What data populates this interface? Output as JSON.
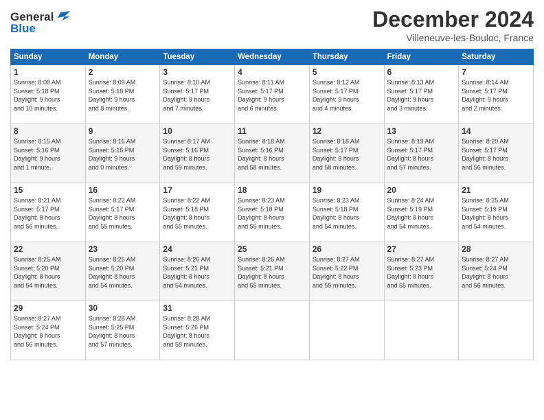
{
  "header": {
    "logo_general": "General",
    "logo_blue": "Blue",
    "month_title": "December 2024",
    "location": "Villeneuve-les-Bouloc, France"
  },
  "days_of_week": [
    "Sunday",
    "Monday",
    "Tuesday",
    "Wednesday",
    "Thursday",
    "Friday",
    "Saturday"
  ],
  "weeks": [
    [
      {
        "day": "1",
        "lines": [
          "Sunrise: 8:08 AM",
          "Sunset: 5:18 PM",
          "Daylight: 9 hours",
          "and 10 minutes."
        ]
      },
      {
        "day": "2",
        "lines": [
          "Sunrise: 8:09 AM",
          "Sunset: 5:18 PM",
          "Daylight: 9 hours",
          "and 8 minutes."
        ]
      },
      {
        "day": "3",
        "lines": [
          "Sunrise: 8:10 AM",
          "Sunset: 5:17 PM",
          "Daylight: 9 hours",
          "and 7 minutes."
        ]
      },
      {
        "day": "4",
        "lines": [
          "Sunrise: 8:11 AM",
          "Sunset: 5:17 PM",
          "Daylight: 9 hours",
          "and 6 minutes."
        ]
      },
      {
        "day": "5",
        "lines": [
          "Sunrise: 8:12 AM",
          "Sunset: 5:17 PM",
          "Daylight: 9 hours",
          "and 4 minutes."
        ]
      },
      {
        "day": "6",
        "lines": [
          "Sunrise: 8:13 AM",
          "Sunset: 5:17 PM",
          "Daylight: 9 hours",
          "and 3 minutes."
        ]
      },
      {
        "day": "7",
        "lines": [
          "Sunrise: 8:14 AM",
          "Sunset: 5:17 PM",
          "Daylight: 9 hours",
          "and 2 minutes."
        ]
      }
    ],
    [
      {
        "day": "8",
        "lines": [
          "Sunrise: 8:15 AM",
          "Sunset: 5:16 PM",
          "Daylight: 9 hours",
          "and 1 minute."
        ]
      },
      {
        "day": "9",
        "lines": [
          "Sunrise: 8:16 AM",
          "Sunset: 5:16 PM",
          "Daylight: 9 hours",
          "and 0 minutes."
        ]
      },
      {
        "day": "10",
        "lines": [
          "Sunrise: 8:17 AM",
          "Sunset: 5:16 PM",
          "Daylight: 8 hours",
          "and 59 minutes."
        ]
      },
      {
        "day": "11",
        "lines": [
          "Sunrise: 8:18 AM",
          "Sunset: 5:16 PM",
          "Daylight: 8 hours",
          "and 58 minutes."
        ]
      },
      {
        "day": "12",
        "lines": [
          "Sunrise: 8:18 AM",
          "Sunset: 5:17 PM",
          "Daylight: 8 hours",
          "and 58 minutes."
        ]
      },
      {
        "day": "13",
        "lines": [
          "Sunrise: 8:19 AM",
          "Sunset: 5:17 PM",
          "Daylight: 8 hours",
          "and 57 minutes."
        ]
      },
      {
        "day": "14",
        "lines": [
          "Sunrise: 8:20 AM",
          "Sunset: 5:17 PM",
          "Daylight: 8 hours",
          "and 56 minutes."
        ]
      }
    ],
    [
      {
        "day": "15",
        "lines": [
          "Sunrise: 8:21 AM",
          "Sunset: 5:17 PM",
          "Daylight: 8 hours",
          "and 56 minutes."
        ]
      },
      {
        "day": "16",
        "lines": [
          "Sunrise: 8:22 AM",
          "Sunset: 5:17 PM",
          "Daylight: 8 hours",
          "and 55 minutes."
        ]
      },
      {
        "day": "17",
        "lines": [
          "Sunrise: 8:22 AM",
          "Sunset: 5:18 PM",
          "Daylight: 8 hours",
          "and 55 minutes."
        ]
      },
      {
        "day": "18",
        "lines": [
          "Sunrise: 8:23 AM",
          "Sunset: 5:18 PM",
          "Daylight: 8 hours",
          "and 55 minutes."
        ]
      },
      {
        "day": "19",
        "lines": [
          "Sunrise: 8:23 AM",
          "Sunset: 5:18 PM",
          "Daylight: 8 hours",
          "and 54 minutes."
        ]
      },
      {
        "day": "20",
        "lines": [
          "Sunrise: 8:24 AM",
          "Sunset: 5:19 PM",
          "Daylight: 8 hours",
          "and 54 minutes."
        ]
      },
      {
        "day": "21",
        "lines": [
          "Sunrise: 8:25 AM",
          "Sunset: 5:19 PM",
          "Daylight: 8 hours",
          "and 54 minutes."
        ]
      }
    ],
    [
      {
        "day": "22",
        "lines": [
          "Sunrise: 8:25 AM",
          "Sunset: 5:20 PM",
          "Daylight: 8 hours",
          "and 54 minutes."
        ]
      },
      {
        "day": "23",
        "lines": [
          "Sunrise: 8:25 AM",
          "Sunset: 5:20 PM",
          "Daylight: 8 hours",
          "and 54 minutes."
        ]
      },
      {
        "day": "24",
        "lines": [
          "Sunrise: 8:26 AM",
          "Sunset: 5:21 PM",
          "Daylight: 8 hours",
          "and 54 minutes."
        ]
      },
      {
        "day": "25",
        "lines": [
          "Sunrise: 8:26 AM",
          "Sunset: 5:21 PM",
          "Daylight: 8 hours",
          "and 55 minutes."
        ]
      },
      {
        "day": "26",
        "lines": [
          "Sunrise: 8:27 AM",
          "Sunset: 5:22 PM",
          "Daylight: 8 hours",
          "and 55 minutes."
        ]
      },
      {
        "day": "27",
        "lines": [
          "Sunrise: 8:27 AM",
          "Sunset: 5:23 PM",
          "Daylight: 8 hours",
          "and 55 minutes."
        ]
      },
      {
        "day": "28",
        "lines": [
          "Sunrise: 8:27 AM",
          "Sunset: 5:24 PM",
          "Daylight: 8 hours",
          "and 56 minutes."
        ]
      }
    ],
    [
      {
        "day": "29",
        "lines": [
          "Sunrise: 8:27 AM",
          "Sunset: 5:24 PM",
          "Daylight: 8 hours",
          "and 56 minutes."
        ]
      },
      {
        "day": "30",
        "lines": [
          "Sunrise: 8:28 AM",
          "Sunset: 5:25 PM",
          "Daylight: 8 hours",
          "and 57 minutes."
        ]
      },
      {
        "day": "31",
        "lines": [
          "Sunrise: 8:28 AM",
          "Sunset: 5:26 PM",
          "Daylight: 8 hours",
          "and 58 minutes."
        ]
      },
      null,
      null,
      null,
      null
    ]
  ]
}
